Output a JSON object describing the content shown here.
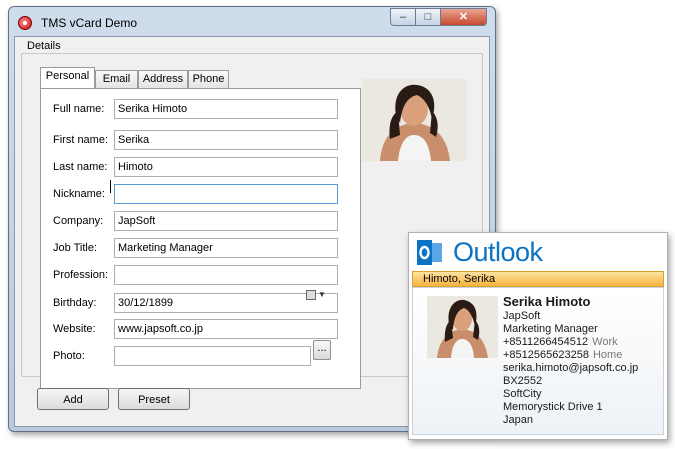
{
  "window": {
    "title": "TMS vCard Demo",
    "minimize_glyph": "–",
    "maximize_glyph": "□",
    "close_glyph": "✕"
  },
  "group": {
    "label": "Details"
  },
  "tabs": [
    {
      "label": "Personal",
      "active": true
    },
    {
      "label": "Email"
    },
    {
      "label": "Address"
    },
    {
      "label": "Phone"
    }
  ],
  "fields": {
    "full_name": {
      "label": "Full name:",
      "value": "Serika Himoto"
    },
    "first_name": {
      "label": "First name:",
      "value": "Serika"
    },
    "last_name": {
      "label": "Last name:",
      "value": "Himoto"
    },
    "nickname": {
      "label": "Nickname:",
      "value": ""
    },
    "company": {
      "label": "Company:",
      "value": "JapSoft"
    },
    "job_title": {
      "label": "Job Title:",
      "value": "Marketing Manager"
    },
    "profession": {
      "label": "Profession:",
      "value": ""
    },
    "birthday": {
      "label": "Birthday:",
      "value": "30/12/1899"
    },
    "website": {
      "label": "Website:",
      "value": "www.japsoft.co.jp"
    },
    "photo": {
      "label": "Photo:",
      "value": "",
      "browse_label": "..."
    }
  },
  "buttons": {
    "add": "Add",
    "preset": "Preset"
  },
  "outlook": {
    "brand": "Outlook",
    "header": "Himoto, Serika",
    "name": "Serika Himoto",
    "company": "JapSoft",
    "title": "Marketing Manager",
    "phone_work": "+8511266454512",
    "phone_work_type": "Work",
    "phone_home": "+8512565623258",
    "phone_home_type": "Home",
    "email": "serika.himoto@japsoft.co.jp",
    "postal": "BX2552",
    "city": "SoftCity",
    "street": "Memorystick Drive 1",
    "country": "Japan"
  },
  "colors": {
    "outlook_blue": "#0b72c4",
    "header_orange": "#f6b43e",
    "close_red": "#c74a2d"
  },
  "icons": [
    "app-icon",
    "calendar-icon",
    "chevron-down-icon",
    "outlook-logo-icon"
  ]
}
